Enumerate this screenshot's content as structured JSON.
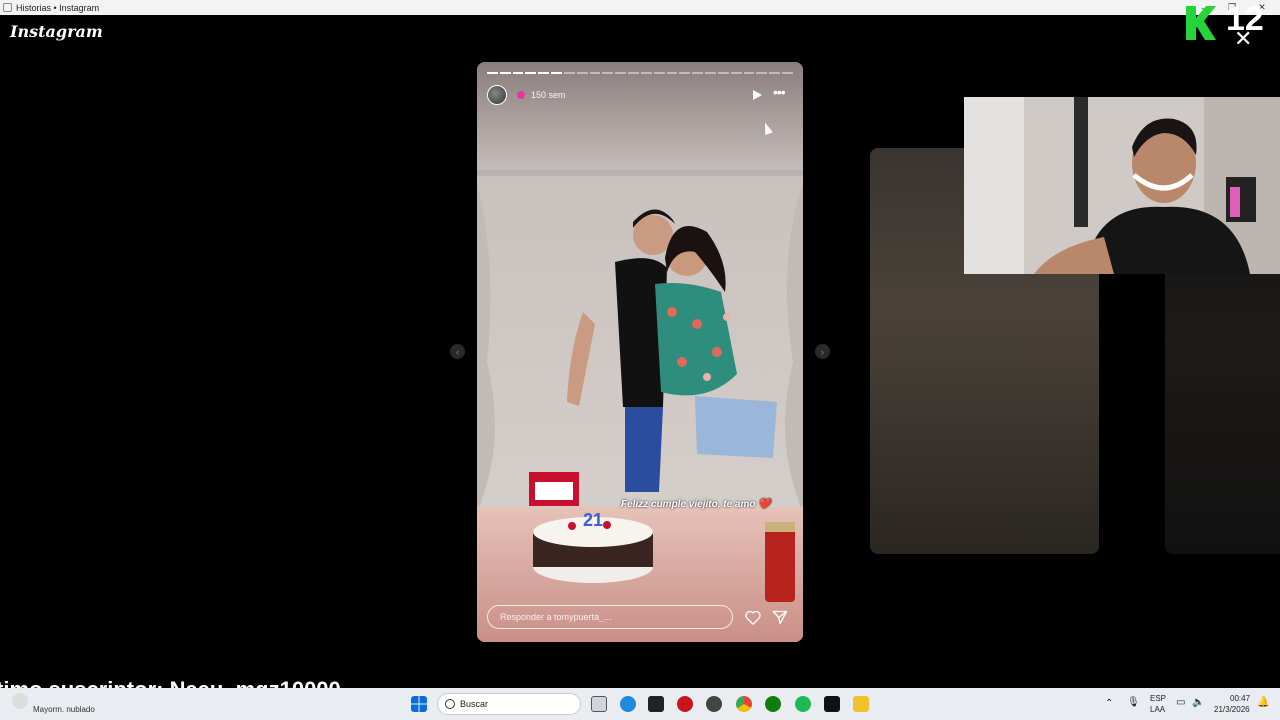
{
  "window": {
    "title": "Historias • Instagram",
    "controls": [
      "–",
      "❐",
      "✕"
    ]
  },
  "app": {
    "logo": "Instagram"
  },
  "overlay": {
    "brand_letter": "K",
    "brand_number": "12",
    "close_glyph": "✕",
    "banner": "timo suscriptor: Naau_mqz10000"
  },
  "story": {
    "progress_segments_total": 24,
    "progress_segments_done": 6,
    "time_ago": "150 sem",
    "more_glyph": "•••",
    "caption": "Felizz cumple viejito, te amo ❤️",
    "reply_placeholder": "Responder a tomypuerta_...",
    "cake_number": "21"
  },
  "nav": {
    "prev_glyph": "‹",
    "next_glyph": "›"
  },
  "taskbar": {
    "weather_text": "Mayorm. nublado",
    "search_label": "Buscar",
    "lang_top": "ESP",
    "lang_bottom": "LAA",
    "time": "00:47",
    "date": "21/3/2026"
  },
  "colors": {
    "background": "#000000",
    "brand_green": "#27d33b",
    "story_bg": "#cfc7c2"
  }
}
